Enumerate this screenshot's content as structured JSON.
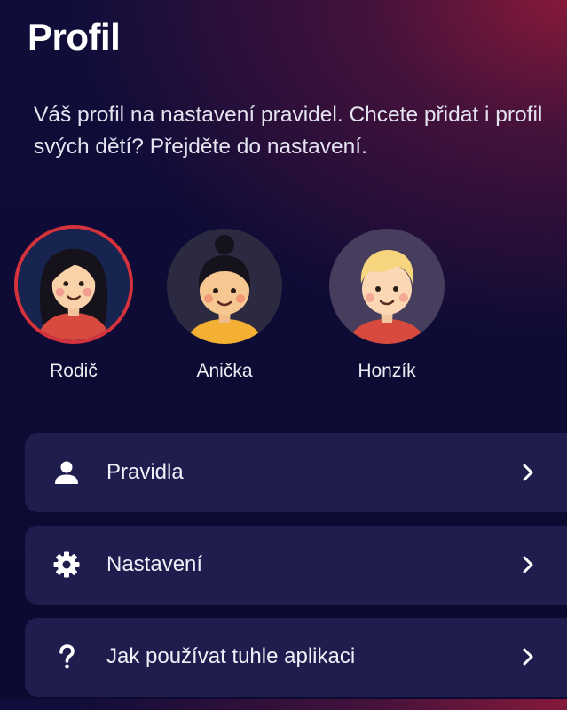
{
  "header": {
    "title": "Profil",
    "description": "Váš profil na nastavení pravidel. Chcete přidat i profil svých dětí? Přejděte do nastavení."
  },
  "profiles": [
    {
      "name": "Rodič",
      "avatar": "woman-avatar-icon",
      "selected": true
    },
    {
      "name": "Anička",
      "avatar": "girl-avatar-icon",
      "selected": false
    },
    {
      "name": "Honzík",
      "avatar": "boy-avatar-icon",
      "selected": false
    }
  ],
  "menu": {
    "items": [
      {
        "label": "Pravidla",
        "icon": "person-icon"
      },
      {
        "label": "Nastavení",
        "icon": "gear-icon"
      },
      {
        "label": "Jak používat tuhle aplikaci",
        "icon": "question-icon"
      }
    ],
    "chevron_icon": "chevron-right-icon"
  },
  "colors": {
    "background": "#0f0c36",
    "accent_gradient": "#8c1a3a",
    "card": "#1f1d4e",
    "selected_border": "#d4333d",
    "text": "#ffffff"
  }
}
